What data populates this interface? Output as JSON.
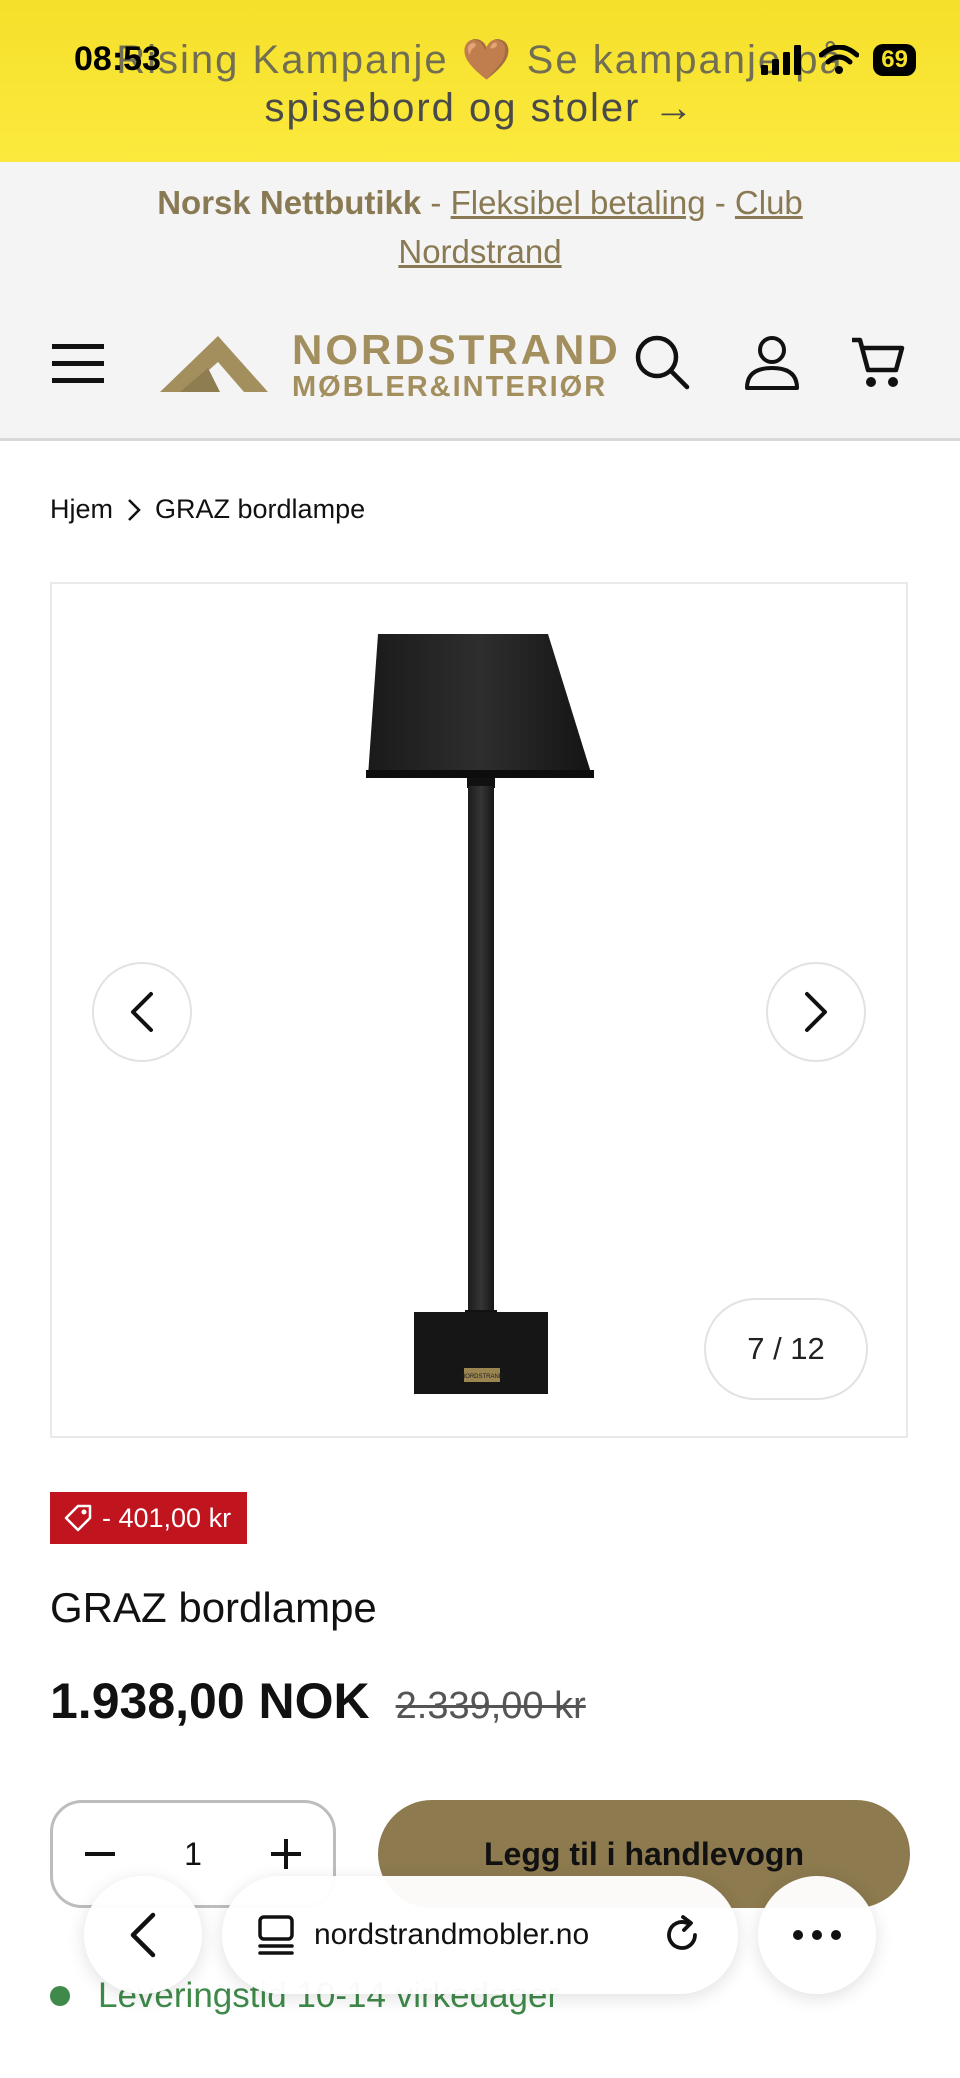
{
  "status": {
    "time": "08:53",
    "battery": "69"
  },
  "announcement": {
    "line1": "Rising Kampanje 🤎 Se kampanje på",
    "line2": "spisebord og stoler  →"
  },
  "trust": {
    "shop": "Norsk Nettbutikk",
    "sep1": " - ",
    "payment": "Fleksibel betaling",
    "sep2": " - ",
    "club": "Club Nordstrand"
  },
  "header": {
    "logo_line1": "NORDSTRAND",
    "logo_line2": "MØBLER&INTERIØR",
    "icons": [
      "menu-icon",
      "search-icon",
      "account-icon",
      "cart-icon"
    ]
  },
  "breadcrumb": {
    "home": "Hjem",
    "current": "GRAZ bordlampe"
  },
  "gallery": {
    "counter": "7 / 12",
    "plate_text": "NORDSTRAND"
  },
  "product": {
    "badge": "- 401,00 kr",
    "title": "GRAZ bordlampe",
    "price": "1.938,00 NOK",
    "old_price": "2.339,00 kr",
    "quantity": "1",
    "add_to_cart": "Legg til i handlevogn",
    "delivery": "Leveringstid 10-14 virkedager"
  },
  "browser": {
    "url": "nordstrandmobler.no"
  },
  "colors": {
    "accent": "#8d7a4f",
    "sale": "#c0141f",
    "announce": "#f5e02a",
    "stock": "#3f8a4a"
  }
}
